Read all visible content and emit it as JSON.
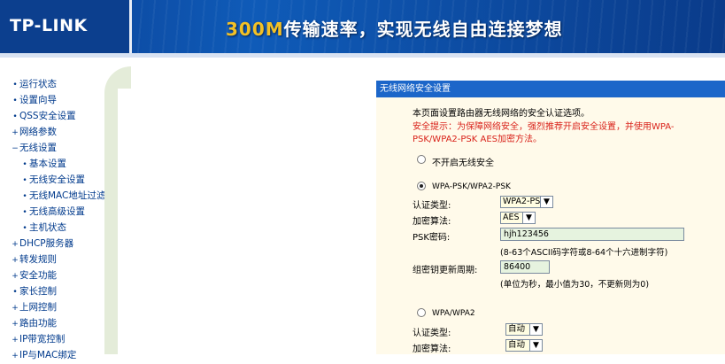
{
  "header": {
    "logo": "TP-LINK",
    "slogan_prefix": "300M",
    "slogan_rest": "传输速率，实现无线自由连接梦想"
  },
  "sidebar": {
    "items": [
      {
        "label": "运行状态",
        "bullet": "•",
        "level": "top"
      },
      {
        "label": "设置向导",
        "bullet": "•",
        "level": "top"
      },
      {
        "label": "QSS安全设置",
        "bullet": "•",
        "level": "top"
      },
      {
        "label": "网络参数",
        "bullet": "+",
        "level": "top"
      },
      {
        "label": "无线设置",
        "bullet": "−",
        "level": "top"
      },
      {
        "label": "基本设置",
        "bullet": "•",
        "level": "sub"
      },
      {
        "label": "无线安全设置",
        "bullet": "•",
        "level": "sub"
      },
      {
        "label": "无线MAC地址过滤",
        "bullet": "•",
        "level": "sub"
      },
      {
        "label": "无线高级设置",
        "bullet": "•",
        "level": "sub"
      },
      {
        "label": "主机状态",
        "bullet": "•",
        "level": "sub"
      },
      {
        "label": "DHCP服务器",
        "bullet": "+",
        "level": "top"
      },
      {
        "label": "转发规则",
        "bullet": "+",
        "level": "top"
      },
      {
        "label": "安全功能",
        "bullet": "+",
        "level": "top"
      },
      {
        "label": "家长控制",
        "bullet": "•",
        "level": "top"
      },
      {
        "label": "上网控制",
        "bullet": "+",
        "level": "top"
      },
      {
        "label": "路由功能",
        "bullet": "+",
        "level": "top"
      },
      {
        "label": "IP带宽控制",
        "bullet": "+",
        "level": "top"
      },
      {
        "label": "IP与MAC绑定",
        "bullet": "+",
        "level": "top"
      }
    ]
  },
  "panel": {
    "title": "无线网络安全设置",
    "intro": "本页面设置路由器无线网络的安全认证选项。",
    "warning_line1": "安全提示：为保障网络安全，强烈推荐开启安全设置，并使用WPA-",
    "warning_line2": "PSK/WPA2-PSK AES加密方法。",
    "opt_none_label": "不开启无线安全",
    "opt_psk_label": "WPA-PSK/WPA2-PSK",
    "auth_label": "认证类型:",
    "auth_value": "WPA2-PSK",
    "enc_label": "加密算法:",
    "enc_value": "AES",
    "psk_label": "PSK密码:",
    "psk_value": "hjh123456",
    "psk_hint": "(8-63个ASCII码字符或8-64个十六进制字符)",
    "renew_label": "组密钥更新周期:",
    "renew_value": "86400",
    "renew_hint": "(单位为秒，最小值为30，不更新则为0)",
    "opt_wpa_label": "WPA/WPA2",
    "auth2_label": "认证类型:",
    "auth2_value": "自动",
    "enc2_label": "加密算法:",
    "enc2_value": "自动"
  }
}
